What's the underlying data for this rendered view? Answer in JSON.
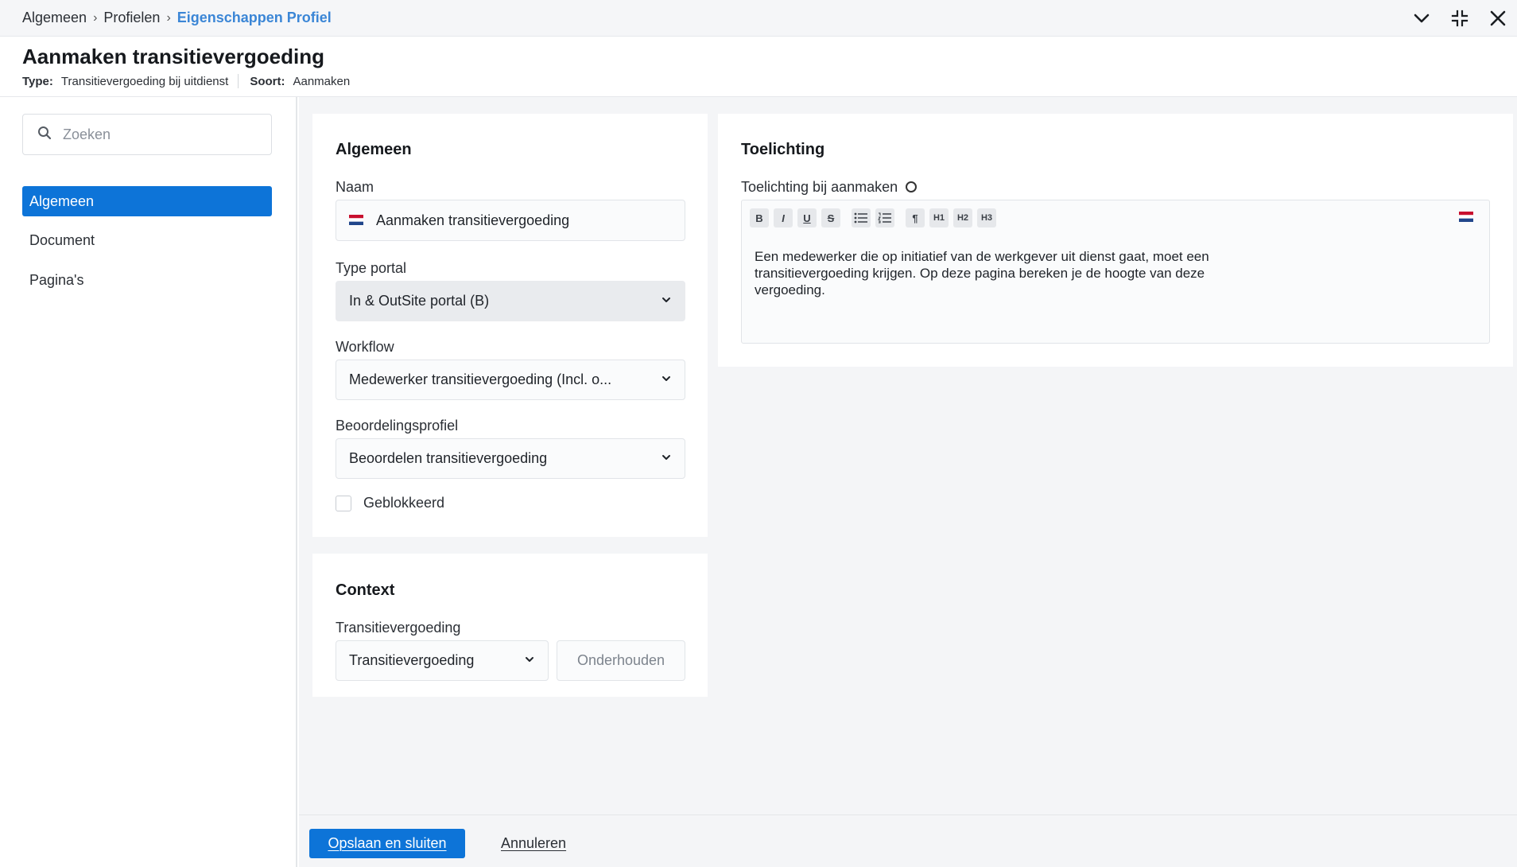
{
  "breadcrumb": {
    "items": [
      "Algemeen",
      "Profielen"
    ],
    "current": "Eigenschappen Profiel",
    "separator": "›"
  },
  "window_controls": {
    "collapse_icon": "chevron-down-icon",
    "minimize_icon": "compress-icon",
    "close_icon": "close-icon"
  },
  "header": {
    "title": "Aanmaken transitievergoeding",
    "type_label": "Type:",
    "type_value": "Transitievergoeding bij uitdienst",
    "soort_label": "Soort:",
    "soort_value": "Aanmaken"
  },
  "sidebar": {
    "search_placeholder": "Zoeken",
    "items": [
      {
        "label": "Algemeen",
        "active": true
      },
      {
        "label": "Document",
        "active": false
      },
      {
        "label": "Pagina's",
        "active": false
      }
    ]
  },
  "algemeen_card": {
    "title": "Algemeen",
    "naam_label": "Naam",
    "naam_value": "Aanmaken transitievergoeding",
    "type_portal_label": "Type portal",
    "type_portal_value": "In & OutSite portal (B)",
    "workflow_label": "Workflow",
    "workflow_value": "Medewerker transitievergoeding (Incl. o...",
    "beoordeling_label": "Beoordelingsprofiel",
    "beoordeling_value": "Beoordelen transitievergoeding",
    "geblokkeerd_label": "Geblokkeerd",
    "geblokkeerd_checked": false
  },
  "context_card": {
    "title": "Context",
    "transitie_label": "Transitievergoeding",
    "transitie_value": "Transitievergoeding",
    "onderhouden_label": "Onderhouden"
  },
  "toelichting_card": {
    "title": "Toelichting",
    "field_label": "Toelichting bij aanmaken",
    "toolbar": {
      "bold": "B",
      "italic": "I",
      "underline": "U",
      "strike": "S",
      "paragraph": "¶",
      "h1": "H1",
      "h2": "H2",
      "h3": "H3"
    },
    "text": "Een medewerker die op initiatief van de werkgever uit dienst gaat, moet een transitievergoeding krijgen. Op deze pagina bereken je de hoogte van deze vergoeding."
  },
  "footer": {
    "save_label": "Opslaan en sluiten",
    "cancel_label": "Annuleren"
  },
  "colors": {
    "primary": "#0d74d8",
    "breadcrumb_active": "#3b86d6",
    "background": "#f4f5f7"
  }
}
